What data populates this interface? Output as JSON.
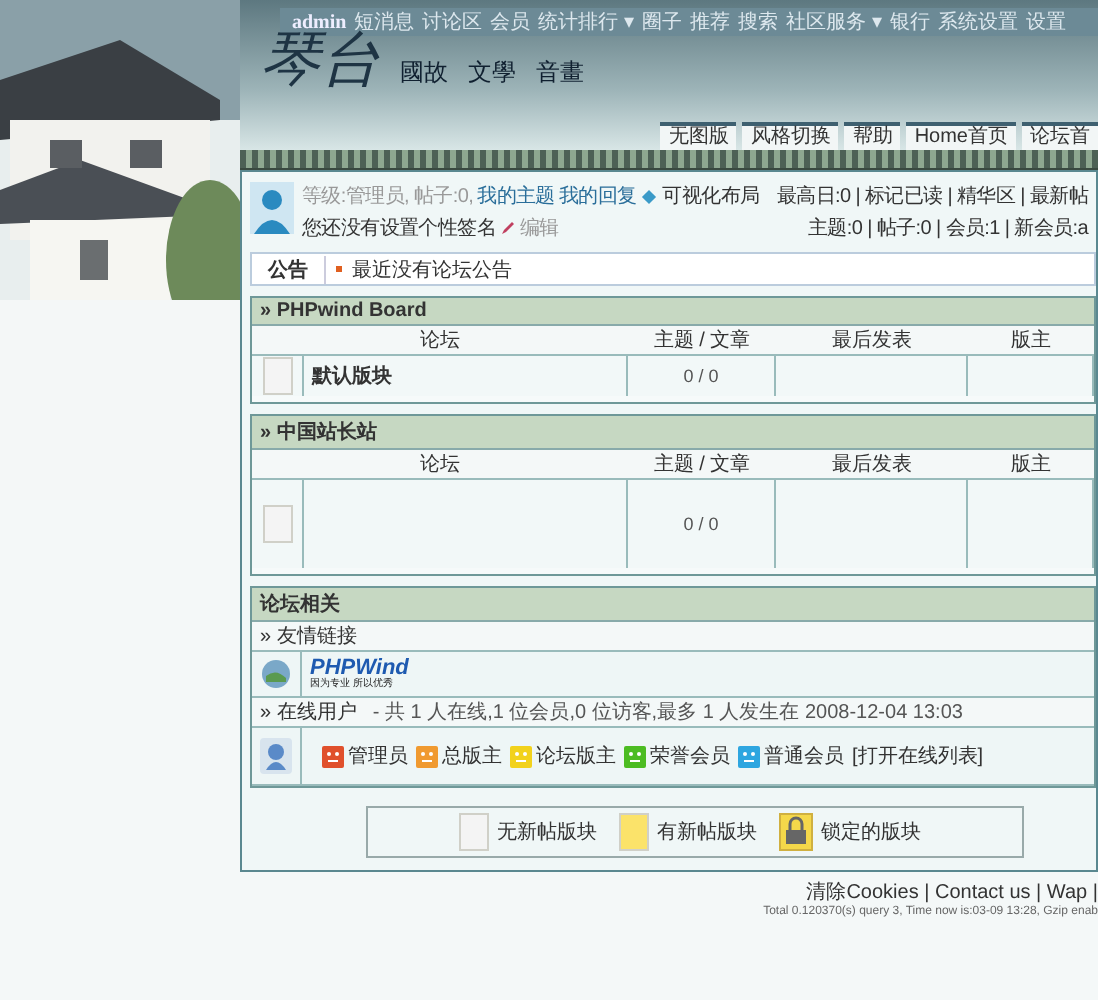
{
  "top_nav": {
    "user": "admin",
    "items": [
      "短消息",
      "讨论区",
      "会员",
      "统计排行 ▾",
      "圈子",
      "推荐",
      "搜索",
      "社区服务 ▾",
      "银行",
      "系统设置",
      "设置"
    ]
  },
  "logo": "琴台",
  "site_menu": [
    "國故",
    "文學",
    "音畫"
  ],
  "tabs": [
    "无图版",
    "风格切换",
    "帮助",
    "Home首页",
    "论坛首"
  ],
  "user_panel": {
    "info": "等级:管理员, 帖子:0,",
    "links": [
      "我的主题",
      "我的回复"
    ],
    "layout": "可视化布局",
    "signature": "您还没有设置个性签名",
    "edit": "编辑",
    "stats_1": "最高日:0 | 标记已读 | 精华区 | 最新帖",
    "stats_2": "主题:0 | 帖子:0 | 会员:1 | 新会员:a"
  },
  "notice": {
    "label": "公告",
    "text": "最近没有论坛公告"
  },
  "boards": [
    {
      "title": "» PHPwind Board",
      "columns": [
        "论坛",
        "主题 / 文章",
        "最后发表",
        "版主"
      ],
      "rows": [
        {
          "name": "默认版块",
          "count": "0 / 0"
        }
      ]
    },
    {
      "title": "» 中国站长站",
      "columns": [
        "论坛",
        "主题 / 文章",
        "最后发表",
        "版主"
      ],
      "rows": [
        {
          "count": "0 / 0"
        }
      ]
    }
  ],
  "related": {
    "title": "论坛相关",
    "links_title": "» 友情链接",
    "partner": {
      "name": "PHPWind",
      "slogan": "因为专业 所以优秀"
    },
    "online_title": "» 在线用户",
    "online_summary": "- 共 1 人在线,1 位会员,0 位访客,最多 1 人发生在 2008-12-04 13:03",
    "groups": [
      {
        "label": "管理员",
        "color": "#e0502c"
      },
      {
        "label": "总版主",
        "color": "#f09a30"
      },
      {
        "label": "论坛版主",
        "color": "#f2d21c"
      },
      {
        "label": "荣誉会员",
        "color": "#4cbc22"
      },
      {
        "label": "普通会员",
        "color": "#2ea6e0"
      }
    ],
    "online_list": "[打开在线列表]"
  },
  "legend": [
    {
      "kind": "none",
      "label": "无新帖版块"
    },
    {
      "kind": "new",
      "label": "有新帖版块"
    },
    {
      "kind": "locked",
      "label": "锁定的版块"
    }
  ],
  "footer": {
    "links": "清除Cookies | Contact us | Wap |",
    "stats": "Total 0.120370(s) query 3, Time now is:03-09 13:28, Gzip enab"
  }
}
